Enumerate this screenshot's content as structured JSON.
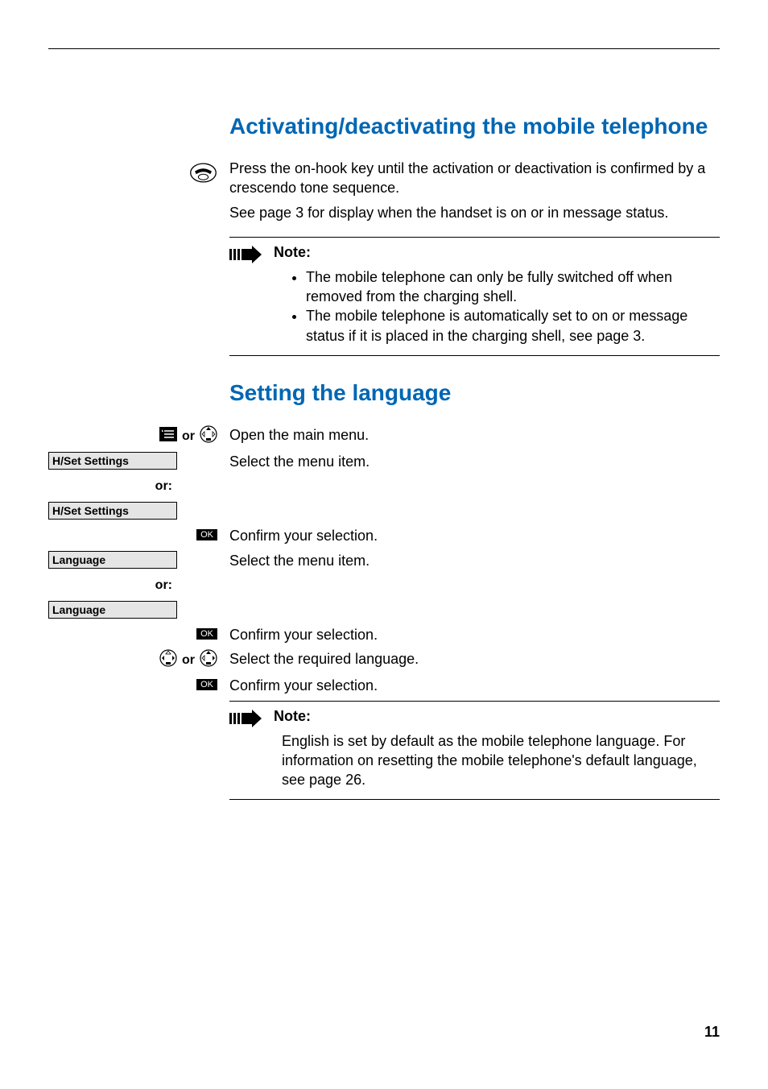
{
  "page_number": "11",
  "section1": {
    "heading": "Activating/deactivating the mobile telephone",
    "para1": "Press the on-hook key until the activation or deactivation is confirmed by a crescendo tone sequence.",
    "para2": "See page 3 for display when the handset is on or in message status.",
    "note_title": "Note:",
    "note_bullets": [
      "The mobile telephone can only be fully switched off when removed from the charging shell.",
      "The mobile telephone is automatically set to on or message status if it is placed in the charging shell, see page 3."
    ]
  },
  "section2": {
    "heading": "Setting the language",
    "steps": {
      "open_menu_or": "or",
      "open_menu": "Open the main menu.",
      "hset1": "H/Set Settings",
      "select_menu1": "Select the menu item.",
      "or1": "or:",
      "hset2": "H/Set Settings",
      "ok1": "OK",
      "confirm1": "Confirm your selection.",
      "lang1": "Language",
      "select_menu2": "Select the menu item.",
      "or2": "or:",
      "lang2": "Language",
      "ok2": "OK",
      "confirm2": "Confirm your selection.",
      "nav_or": "or",
      "select_lang": "Select the required language.",
      "ok3": "OK",
      "confirm3": "Confirm your selection."
    },
    "note_title": "Note:",
    "note_text": "English is set by default as the mobile telephone language. For information on resetting the mobile telephone's default language, see page 26."
  }
}
